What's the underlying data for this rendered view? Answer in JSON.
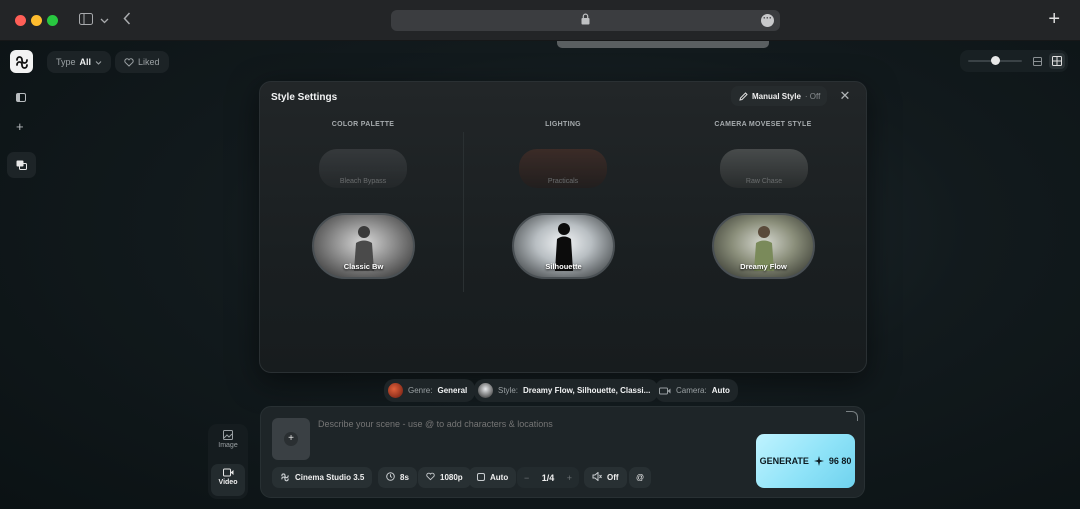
{
  "browser": {
    "plus_tab": "+"
  },
  "filters": {
    "type_label": "Type",
    "type_value": "All",
    "liked_label": "Liked"
  },
  "modal": {
    "title": "Style Settings",
    "manual_label": "Manual Style",
    "manual_state": "· Off",
    "columns": [
      {
        "header": "COLOR PALETTE",
        "small": "Bleach Bypass",
        "large": "Classic Bw",
        "small_color": "#7a7d80",
        "large_color": "#9a9a9a"
      },
      {
        "header": "LIGHTING",
        "small": "Practicals",
        "large": "Silhouette",
        "small_color": "#6a3a2c",
        "large_color": "#e8eaec"
      },
      {
        "header": "CAMERA MOVESET STYLE",
        "small": "Raw Chase",
        "large": "Dreamy Flow",
        "small_color": "#8a8c8a",
        "large_color": "#a9ad96"
      }
    ]
  },
  "chips": {
    "genre_label": "Genre:",
    "genre_value": "General",
    "style_label": "Style:",
    "style_value": "Dreamy Flow, Silhouette, Classi...",
    "camera_label": "Camera:",
    "camera_value": "Auto"
  },
  "mode": {
    "image_label": "Image",
    "video_label": "Video"
  },
  "prompt": {
    "placeholder": "Describe your scene - use @ to add characters & locations",
    "model": "Cinema Studio 3.5",
    "duration": "8s",
    "resolution": "1080p",
    "aspect": "Auto",
    "count": "1/4",
    "audio": "Off",
    "mention": "@",
    "generate_label": "GENERATE",
    "generate_cost": "96 80"
  },
  "colors": {
    "accent": "#8fe3f8",
    "background": "#0d1518"
  }
}
